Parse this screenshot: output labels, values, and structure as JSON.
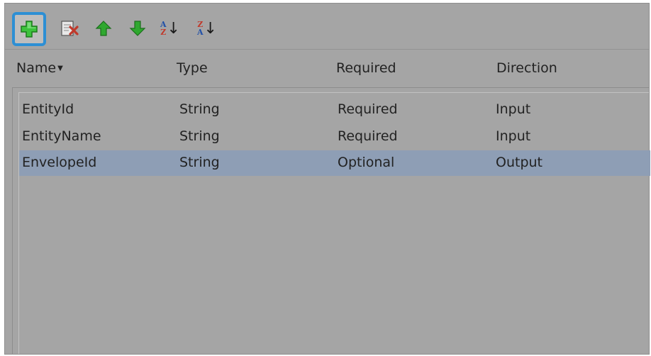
{
  "toolbar": {
    "buttons": [
      {
        "name": "add",
        "icon": "green-plus-icon"
      },
      {
        "name": "delete",
        "icon": "document-delete-icon"
      },
      {
        "name": "move-up",
        "icon": "green-up-arrow-icon"
      },
      {
        "name": "move-down",
        "icon": "green-down-arrow-icon"
      },
      {
        "name": "sort-ascending",
        "icon": "sort-az-icon",
        "top": "A",
        "bottom": "Z"
      },
      {
        "name": "sort-descending",
        "icon": "sort-za-icon",
        "top": "Z",
        "bottom": "A"
      }
    ]
  },
  "columns": {
    "name": "Name",
    "type": "Type",
    "required": "Required",
    "direction": "Direction",
    "sorted_by": "Name"
  },
  "rows": [
    {
      "name": "EntityId",
      "type": "String",
      "required": "Required",
      "direction": "Input",
      "selected": false
    },
    {
      "name": "EntityName",
      "type": "String",
      "required": "Required",
      "direction": "Input",
      "selected": false
    },
    {
      "name": "EnvelopeId",
      "type": "String",
      "required": "Optional",
      "direction": "Output",
      "selected": true
    }
  ],
  "colors": {
    "panel_bg": "#a5a5a5",
    "selection": "#8e9eb5",
    "highlight_border": "#2d8fd4",
    "icon_green": "#2fa82f"
  }
}
